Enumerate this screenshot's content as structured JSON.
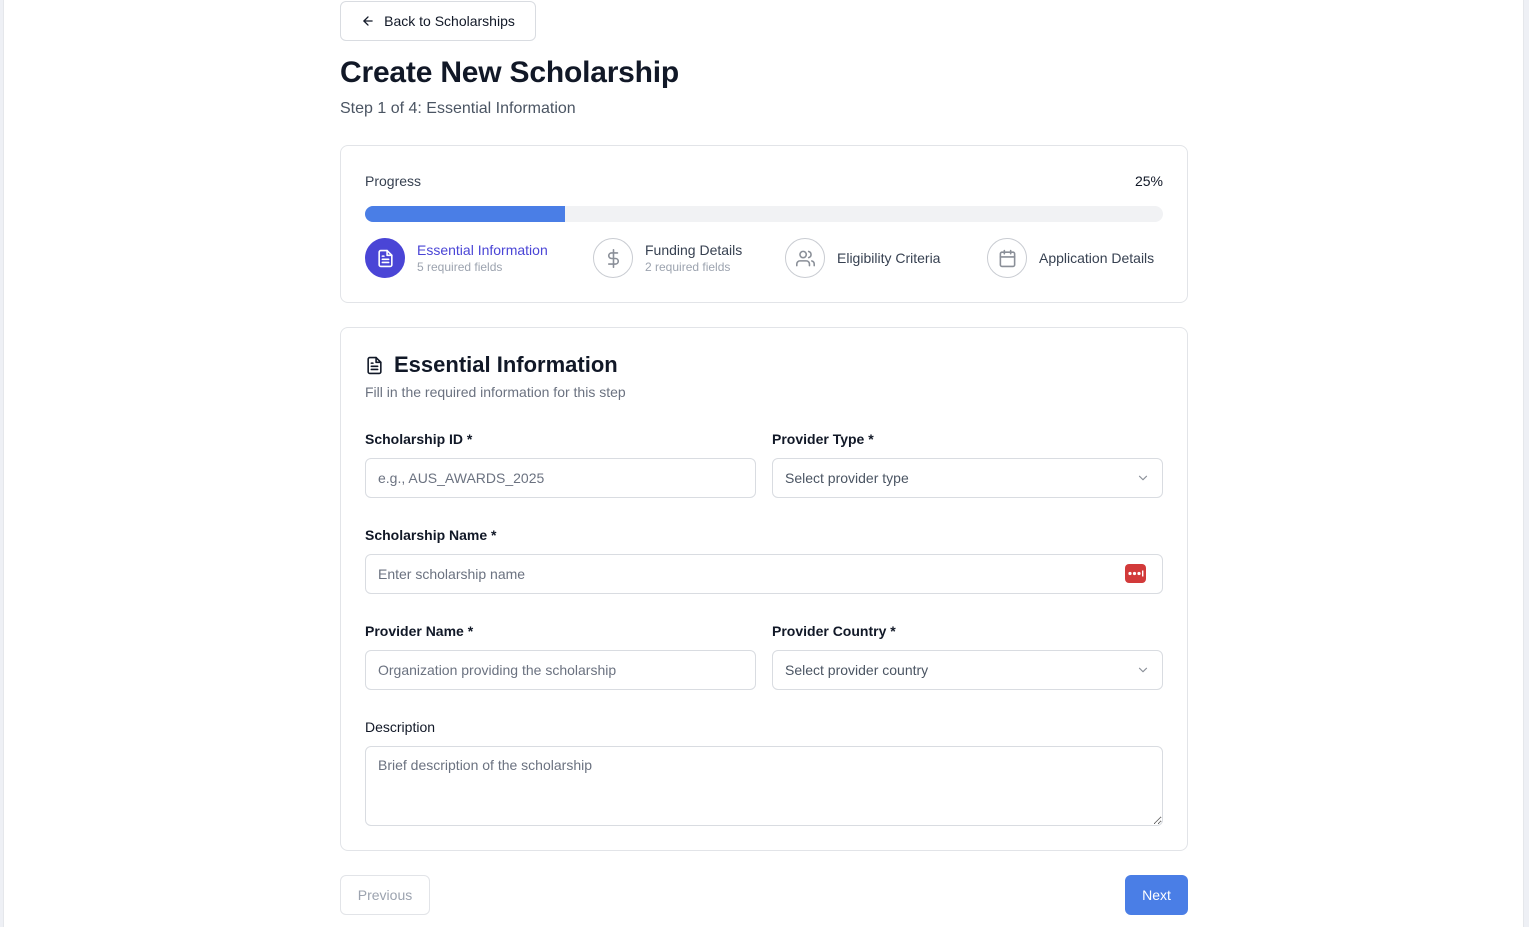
{
  "header": {
    "back_label": "Back to Scholarships",
    "title": "Create New Scholarship",
    "subtitle": "Step 1 of 4: Essential Information"
  },
  "progress": {
    "label": "Progress",
    "percent_label": "25%",
    "percent": 25,
    "fill_color": "#4a7ee6",
    "steps": [
      {
        "title": "Essential Information",
        "sub": "5 required fields",
        "icon": "document-icon",
        "active": true
      },
      {
        "title": "Funding Details",
        "sub": "2 required fields",
        "icon": "dollar-icon",
        "active": false
      },
      {
        "title": "Eligibility Criteria",
        "sub": "",
        "icon": "users-icon",
        "active": false
      },
      {
        "title": "Application Details",
        "sub": "",
        "icon": "calendar-icon",
        "active": false
      }
    ]
  },
  "form": {
    "title": "Essential Information",
    "description": "Fill in the required information for this step",
    "scholarship_id": {
      "label": "Scholarship ID *",
      "value": "",
      "placeholder": "e.g., AUS_AWARDS_2025"
    },
    "provider_type": {
      "label": "Provider Type *",
      "value": "Select provider type"
    },
    "scholarship_name": {
      "label": "Scholarship Name *",
      "value": "",
      "placeholder": "Enter scholarship name"
    },
    "provider_name": {
      "label": "Provider Name *",
      "value": "",
      "placeholder": "Organization providing the scholarship"
    },
    "provider_country": {
      "label": "Provider Country *",
      "value": "Select provider country"
    },
    "description_field": {
      "label": "Description",
      "value": "",
      "placeholder": "Brief description of the scholarship"
    }
  },
  "footer": {
    "previous_label": "Previous",
    "next_label": "Next"
  },
  "colors": {
    "accent": "#4a7ee6",
    "active_step": "#4a45d6",
    "password_badge": "#d23a3a"
  }
}
